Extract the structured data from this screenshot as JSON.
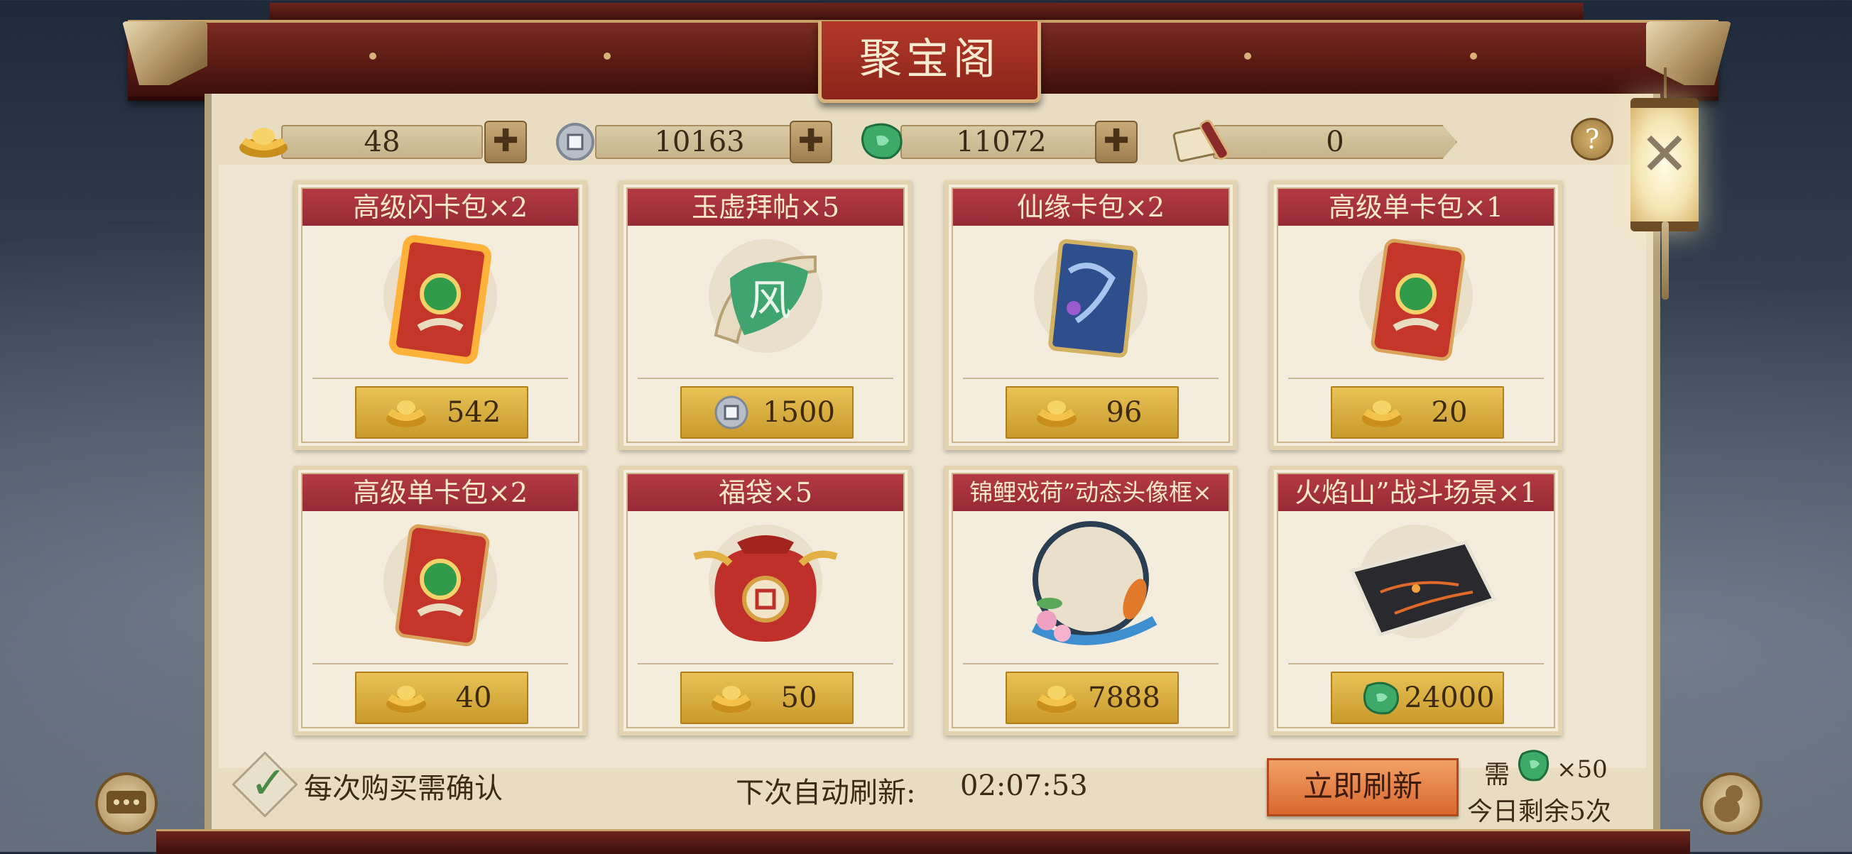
{
  "title": "聚宝阁",
  "currencies": [
    {
      "icon": "gold-ingot-icon",
      "value": "48"
    },
    {
      "icon": "silver-coin-icon",
      "value": "10163"
    },
    {
      "icon": "jade-icon",
      "value": "11072"
    },
    {
      "icon": "scroll-icon",
      "value": "0"
    }
  ],
  "help_label": "?",
  "close_label": "✕",
  "items": [
    {
      "name": "高级闪卡包×2",
      "art": "glowing-card-pack-icon",
      "currency": "gold-ingot-icon",
      "price": "542"
    },
    {
      "name": "玉虚拜帖×5",
      "art": "jade-scroll-icon",
      "currency": "silver-coin-icon",
      "price": "1500"
    },
    {
      "name": "仙缘卡包×2",
      "art": "blue-card-pack-icon",
      "currency": "gold-ingot-icon",
      "price": "96"
    },
    {
      "name": "高级单卡包×1",
      "art": "card-pack-icon",
      "currency": "gold-ingot-icon",
      "price": "20"
    },
    {
      "name": "高级单卡包×2",
      "art": "card-pack-icon",
      "currency": "gold-ingot-icon",
      "price": "40"
    },
    {
      "name": "福袋×5",
      "art": "lucky-bag-icon",
      "currency": "gold-ingot-icon",
      "price": "50"
    },
    {
      "name": "锦鲤戏荷”动态头像框×",
      "art": "koi-avatar-frame-icon",
      "currency": "gold-ingot-icon",
      "price": "7888"
    },
    {
      "name": "火焰山”战斗场景×1",
      "art": "battle-scene-icon",
      "currency": "jade-icon",
      "price": "24000"
    }
  ],
  "confirm_each_purchase": {
    "label": "每次购买需确认",
    "checked": true
  },
  "auto_refresh": {
    "label": "下次自动刷新:",
    "time": "02:07:53"
  },
  "refresh_button": "立即刷新",
  "refresh_cost": {
    "need_label": "需",
    "count": "×50",
    "currency": "jade-icon"
  },
  "remaining_today": "今日剩余5次",
  "colors": {
    "title_red": "#b3382a",
    "card_title_red": "#b43a45",
    "price_gold": "#e9c255",
    "refresh_orange": "#d9672e"
  }
}
